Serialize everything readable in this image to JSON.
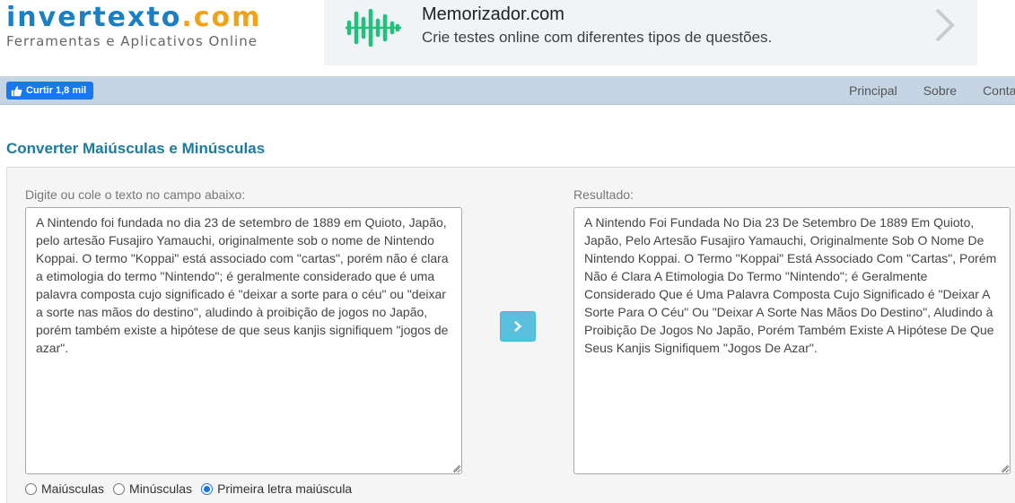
{
  "logo": {
    "brand": "invertexto",
    "tld": ".com",
    "tagline": "Ferramentas e Aplicativos Online"
  },
  "ad": {
    "title": "Memorizador.com",
    "text": "Crie testes online com diferentes tipos de questões.",
    "icon": "soundwave-icon",
    "accent": "#1fc27a"
  },
  "social": {
    "like_label": "Curtir 1,8 mil",
    "color": "#1877f2"
  },
  "nav": {
    "items": [
      "Principal",
      "Sobre",
      "Conta"
    ]
  },
  "page": {
    "title": "Converter Maiúsculas e Minúsculas"
  },
  "input": {
    "label": "Digite ou cole o texto no campo abaixo:",
    "value": "A Nintendo foi fundada no dia 23 de setembro de 1889 em Quioto, Japão, pelo artesão Fusajiro Yamauchi, originalmente sob o nome de Nintendo Koppai. O termo \"Koppai\" está associado com \"cartas\", porém não é clara a etimologia do termo \"Nintendo\"; é geralmente considerado que é uma palavra composta cujo significado é \"deixar a sorte para o céu\" ou \"deixar a sorte nas mãos do destino\", aludindo à proibição de jogos no Japão, porém também existe a hipótese de que seus kanjis signifiquem \"jogos de azar\"."
  },
  "output": {
    "label": "Resultado:",
    "value": "A Nintendo Foi Fundada No Dia 23 De Setembro De 1889 Em Quioto, Japão, Pelo Artesão Fusajiro Yamauchi, Originalmente Sob O Nome De Nintendo Koppai. O Termo \"Koppai\" Está Associado Com \"Cartas\", Porém Não é Clara A Etimologia Do Termo \"Nintendo\"; é Geralmente Considerado Que é Uma Palavra Composta Cujo Significado é \"Deixar A Sorte Para O Céu\" Ou \"Deixar A Sorte Nas Mãos Do Destino\", Aludindo à Proibição De Jogos No Japão, Porém Também Existe A Hipótese De Que Seus Kanjis Signifiquem \"Jogos De Azar\"."
  },
  "convert_button": {
    "icon": "chevron-right-icon",
    "color": "#5bc0de"
  },
  "options": [
    {
      "label": "Maiúsculas",
      "checked": false
    },
    {
      "label": "Minúsculas",
      "checked": false
    },
    {
      "label": "Primeira letra maiúscula",
      "checked": true
    }
  ],
  "colors": {
    "nav_bg": "#c5d5e4",
    "title": "#1f7a9e",
    "brand": "#1b7fc3",
    "tld": "#f0a318"
  }
}
